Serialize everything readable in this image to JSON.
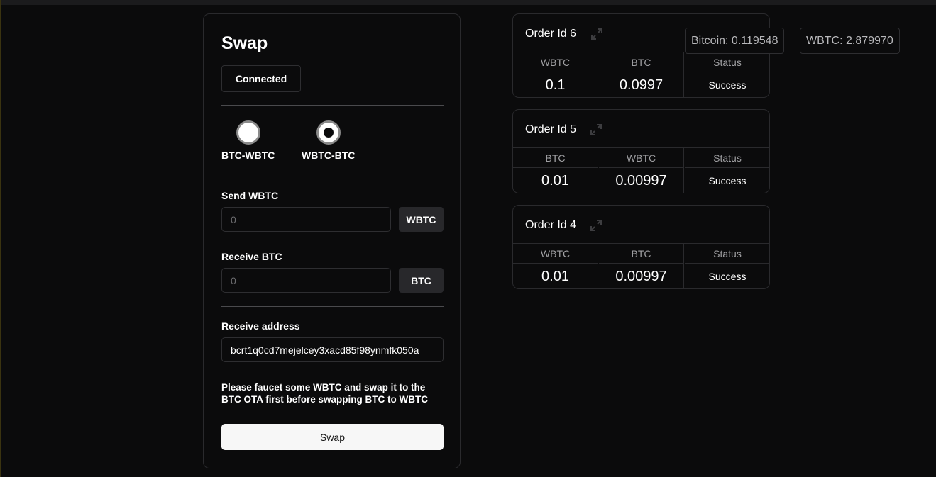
{
  "swap": {
    "title": "Swap",
    "connected_label": "Connected",
    "radio_options": [
      {
        "label": "BTC-WBTC",
        "selected": false
      },
      {
        "label": "WBTC-BTC",
        "selected": true
      }
    ],
    "send_label": "Send WBTC",
    "send_placeholder": "0",
    "send_unit": "WBTC",
    "receive_label": "Receive BTC",
    "receive_placeholder": "0",
    "receive_unit": "BTC",
    "address_label": "Receive address",
    "address_value": "bcrt1q0cd7mejelcey3xacd85f98ynmfk050a",
    "note": "Please faucet some WBTC and swap it to the BTC OTA first before swapping BTC to WBTC",
    "swap_button_label": "Swap"
  },
  "orders": [
    {
      "title": "Order Id 6",
      "headers": [
        "WBTC",
        "BTC",
        "Status"
      ],
      "values": [
        "0.1",
        "0.0997",
        "Success"
      ]
    },
    {
      "title": "Order Id 5",
      "headers": [
        "BTC",
        "WBTC",
        "Status"
      ],
      "values": [
        "0.01",
        "0.00997",
        "Success"
      ]
    },
    {
      "title": "Order Id 4",
      "headers": [
        "WBTC",
        "BTC",
        "Status"
      ],
      "values": [
        "0.01",
        "0.00997",
        "Success"
      ]
    }
  ],
  "balances": {
    "bitcoin": "Bitcoin: 0.119548",
    "wbtc": "WBTC: 2.879970"
  },
  "icons": {
    "expand": "expand-arrows-icon"
  }
}
